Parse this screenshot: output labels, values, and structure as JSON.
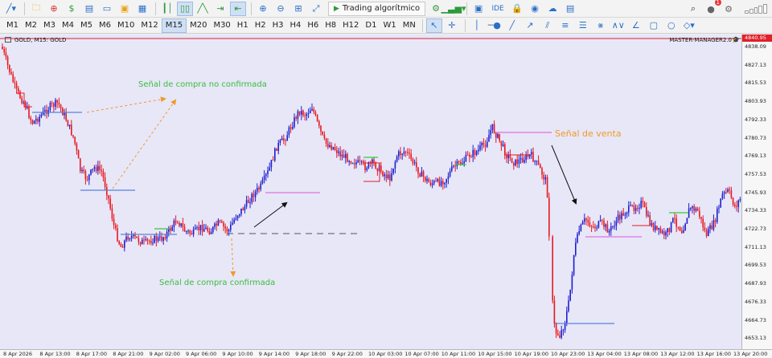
{
  "toolbar": {
    "algo_trading_label": "Trading algorítmico",
    "ide_label": "IDE",
    "notification_count": "1"
  },
  "timeframes": [
    "M1",
    "M2",
    "M3",
    "M4",
    "M5",
    "M6",
    "M10",
    "M12",
    "M15",
    "M20",
    "M30",
    "H1",
    "H2",
    "H3",
    "H4",
    "H6",
    "H8",
    "H12",
    "D1",
    "W1",
    "MN"
  ],
  "active_timeframe": "M15",
  "chart": {
    "symbol_label": "GOLD, M15:  GOLD",
    "expert_label": "MASTER-MANAGER2.0",
    "current_price": "4840.95",
    "bull_color": "#1f1fcf",
    "bear_color": "#e8181e",
    "background": "#e7e7f8"
  },
  "annotations": {
    "buy_unconfirmed": "Señal de compra no confirmada",
    "buy_confirmed": "Señal de compra  confirmada",
    "sell": "Señal de venta"
  },
  "price_axis": [
    "4838.09",
    "4827.13",
    "4815.53",
    "4803.93",
    "4792.33",
    "4780.73",
    "4769.13",
    "4757.53",
    "4745.93",
    "4734.33",
    "4722.73",
    "4711.13",
    "4699.53",
    "4687.93",
    "4676.33",
    "4664.73",
    "4653.13"
  ],
  "time_axis": [
    "8 Apr 2026",
    "8 Apr 13:00",
    "8 Apr 17:00",
    "8 Apr 21:00",
    "9 Apr 02:00",
    "9 Apr 06:00",
    "9 Apr 10:00",
    "9 Apr 14:00",
    "9 Apr 18:00",
    "9 Apr 22:00",
    "10 Apr 03:00",
    "10 Apr 07:00",
    "10 Apr 11:00",
    "10 Apr 15:00",
    "10 Apr 19:00",
    "10 Apr 23:00",
    "13 Apr 04:00",
    "13 Apr 08:00",
    "13 Apr 12:00",
    "13 Apr 16:00",
    "13 Apr 20:00"
  ]
}
